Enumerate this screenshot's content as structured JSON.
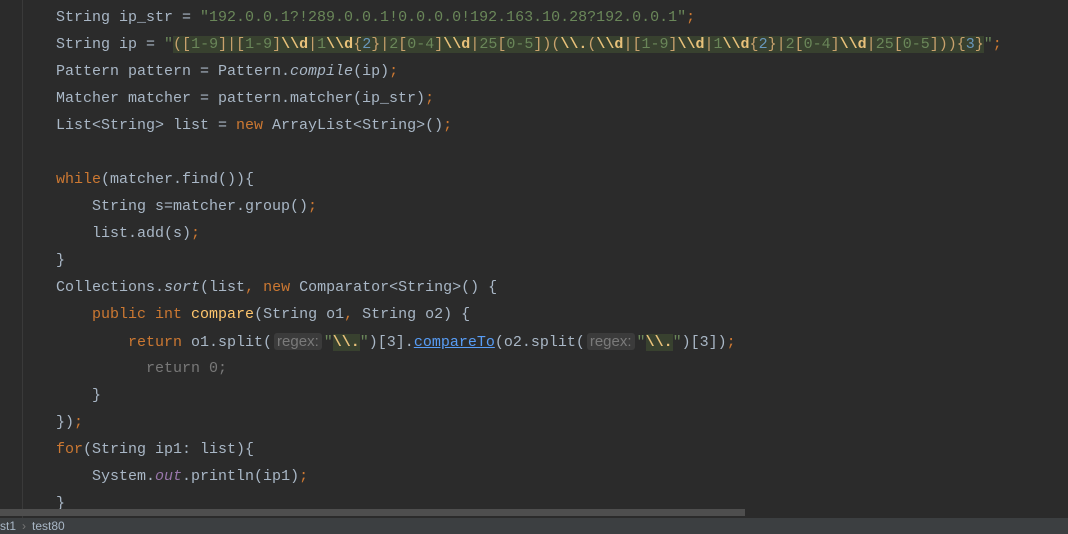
{
  "editor": {
    "lines": [
      [
        [
          "String ip_str = ",
          ""
        ],
        [
          "\"192.0.0.1?!289.0.0.1!0.0.0.0!192.163.10.28?192.0.0.1\"",
          "s"
        ],
        [
          ";",
          "p"
        ]
      ],
      [
        [
          "String ip = ",
          ""
        ],
        [
          "\"",
          "s"
        ],
        [
          "([",
          "rb"
        ],
        [
          "1-9",
          "rs"
        ],
        [
          "]|[",
          "rb"
        ],
        [
          "1-9",
          "rs"
        ],
        [
          "]",
          "rb"
        ],
        [
          "\\\\d",
          "re"
        ],
        [
          "|",
          "rb"
        ],
        [
          "1",
          "rs"
        ],
        [
          "\\\\d",
          "re"
        ],
        [
          "{",
          "rb"
        ],
        [
          "2",
          "rn"
        ],
        [
          "}|",
          "rb"
        ],
        [
          "2",
          "rs"
        ],
        [
          "[",
          "rb"
        ],
        [
          "0-4",
          "rs"
        ],
        [
          "]",
          "rb"
        ],
        [
          "\\\\d",
          "re"
        ],
        [
          "|",
          "rb"
        ],
        [
          "25",
          "rs"
        ],
        [
          "[",
          "rb"
        ],
        [
          "0-5",
          "rs"
        ],
        [
          "])(",
          "rb"
        ],
        [
          "\\\\.",
          "re"
        ],
        [
          "(",
          "rb"
        ],
        [
          "\\\\d",
          "re"
        ],
        [
          "|[",
          "rb"
        ],
        [
          "1-9",
          "rs"
        ],
        [
          "]",
          "rb"
        ],
        [
          "\\\\d",
          "re"
        ],
        [
          "|",
          "rb"
        ],
        [
          "1",
          "rs"
        ],
        [
          "\\\\d",
          "re"
        ],
        [
          "{",
          "rb"
        ],
        [
          "2",
          "rn"
        ],
        [
          "}|",
          "rb"
        ],
        [
          "2",
          "rs"
        ],
        [
          "[",
          "rb"
        ],
        [
          "0-4",
          "rs"
        ],
        [
          "]",
          "rb"
        ],
        [
          "\\\\d",
          "re"
        ],
        [
          "|",
          "rb"
        ],
        [
          "25",
          "rs"
        ],
        [
          "[",
          "rb"
        ],
        [
          "0-5",
          "rs"
        ],
        [
          "])){",
          "rb"
        ],
        [
          "3",
          "rn"
        ],
        [
          "}",
          "rb"
        ],
        [
          "\"",
          "s"
        ],
        [
          ";",
          "p"
        ]
      ],
      [
        [
          "Pattern pattern = Pattern.",
          ""
        ],
        [
          "compile",
          "i"
        ],
        [
          "(ip)",
          ""
        ],
        [
          ";",
          "p"
        ]
      ],
      [
        [
          "Matcher matcher = pattern.matcher(ip_str)",
          ""
        ],
        [
          ";",
          "p"
        ]
      ],
      [
        [
          "List<String> list = ",
          ""
        ],
        [
          "new",
          "k"
        ],
        [
          " ArrayList<String>()",
          ""
        ],
        [
          ";",
          "p"
        ]
      ],
      [],
      [
        [
          "while",
          "k"
        ],
        [
          "(matcher.find()){",
          ""
        ]
      ],
      [
        [
          "    String s=matcher.group()",
          ""
        ],
        [
          ";",
          "p"
        ]
      ],
      [
        [
          "    list.add(s)",
          ""
        ],
        [
          ";",
          "p"
        ]
      ],
      [
        [
          "}",
          ""
        ]
      ],
      [
        [
          "Collections.",
          ""
        ],
        [
          "sort",
          "i"
        ],
        [
          "(list",
          ""
        ],
        [
          ", ",
          "p"
        ],
        [
          "new",
          "k"
        ],
        [
          " Comparator<String>() {",
          ""
        ]
      ],
      [
        [
          "    ",
          ""
        ],
        [
          "public int",
          "k"
        ],
        [
          " ",
          ""
        ],
        [
          "compare",
          "m"
        ],
        [
          "(String o1",
          ""
        ],
        [
          ", ",
          "p"
        ],
        [
          "String o2) {",
          ""
        ]
      ],
      [
        [
          "        ",
          ""
        ],
        [
          "return",
          "k"
        ],
        [
          " o1.split(",
          ""
        ],
        [
          "regex:",
          "h"
        ],
        [
          "\"",
          "s"
        ],
        [
          "\\\\.",
          "re"
        ],
        [
          "\"",
          "s"
        ],
        [
          ")[3].",
          ""
        ],
        [
          "compareTo",
          "l"
        ],
        [
          "(o2.split(",
          ""
        ],
        [
          "regex:",
          "h"
        ],
        [
          "\"",
          "s"
        ],
        [
          "\\\\.",
          "re"
        ],
        [
          "\"",
          "s"
        ],
        [
          ")[3])",
          ""
        ],
        [
          ";",
          "p"
        ]
      ],
      [
        [
          "          return 0;",
          "c"
        ]
      ],
      [
        [
          "    }",
          ""
        ]
      ],
      [
        [
          "})",
          ""
        ],
        [
          ";",
          "p"
        ]
      ],
      [
        [
          "for",
          "k"
        ],
        [
          "(String ip1: list){",
          ""
        ]
      ],
      [
        [
          "    System.",
          ""
        ],
        [
          "out",
          "f"
        ],
        [
          ".println(ip1)",
          ""
        ],
        [
          ";",
          "p"
        ]
      ],
      [
        [
          "}",
          ""
        ]
      ]
    ]
  },
  "breadcrumb": [
    "st1",
    "test80"
  ],
  "colors": {
    "background": "#2b2b2b",
    "keyword": "#cc7832",
    "string": "#6a8759",
    "number": "#6897bb"
  }
}
